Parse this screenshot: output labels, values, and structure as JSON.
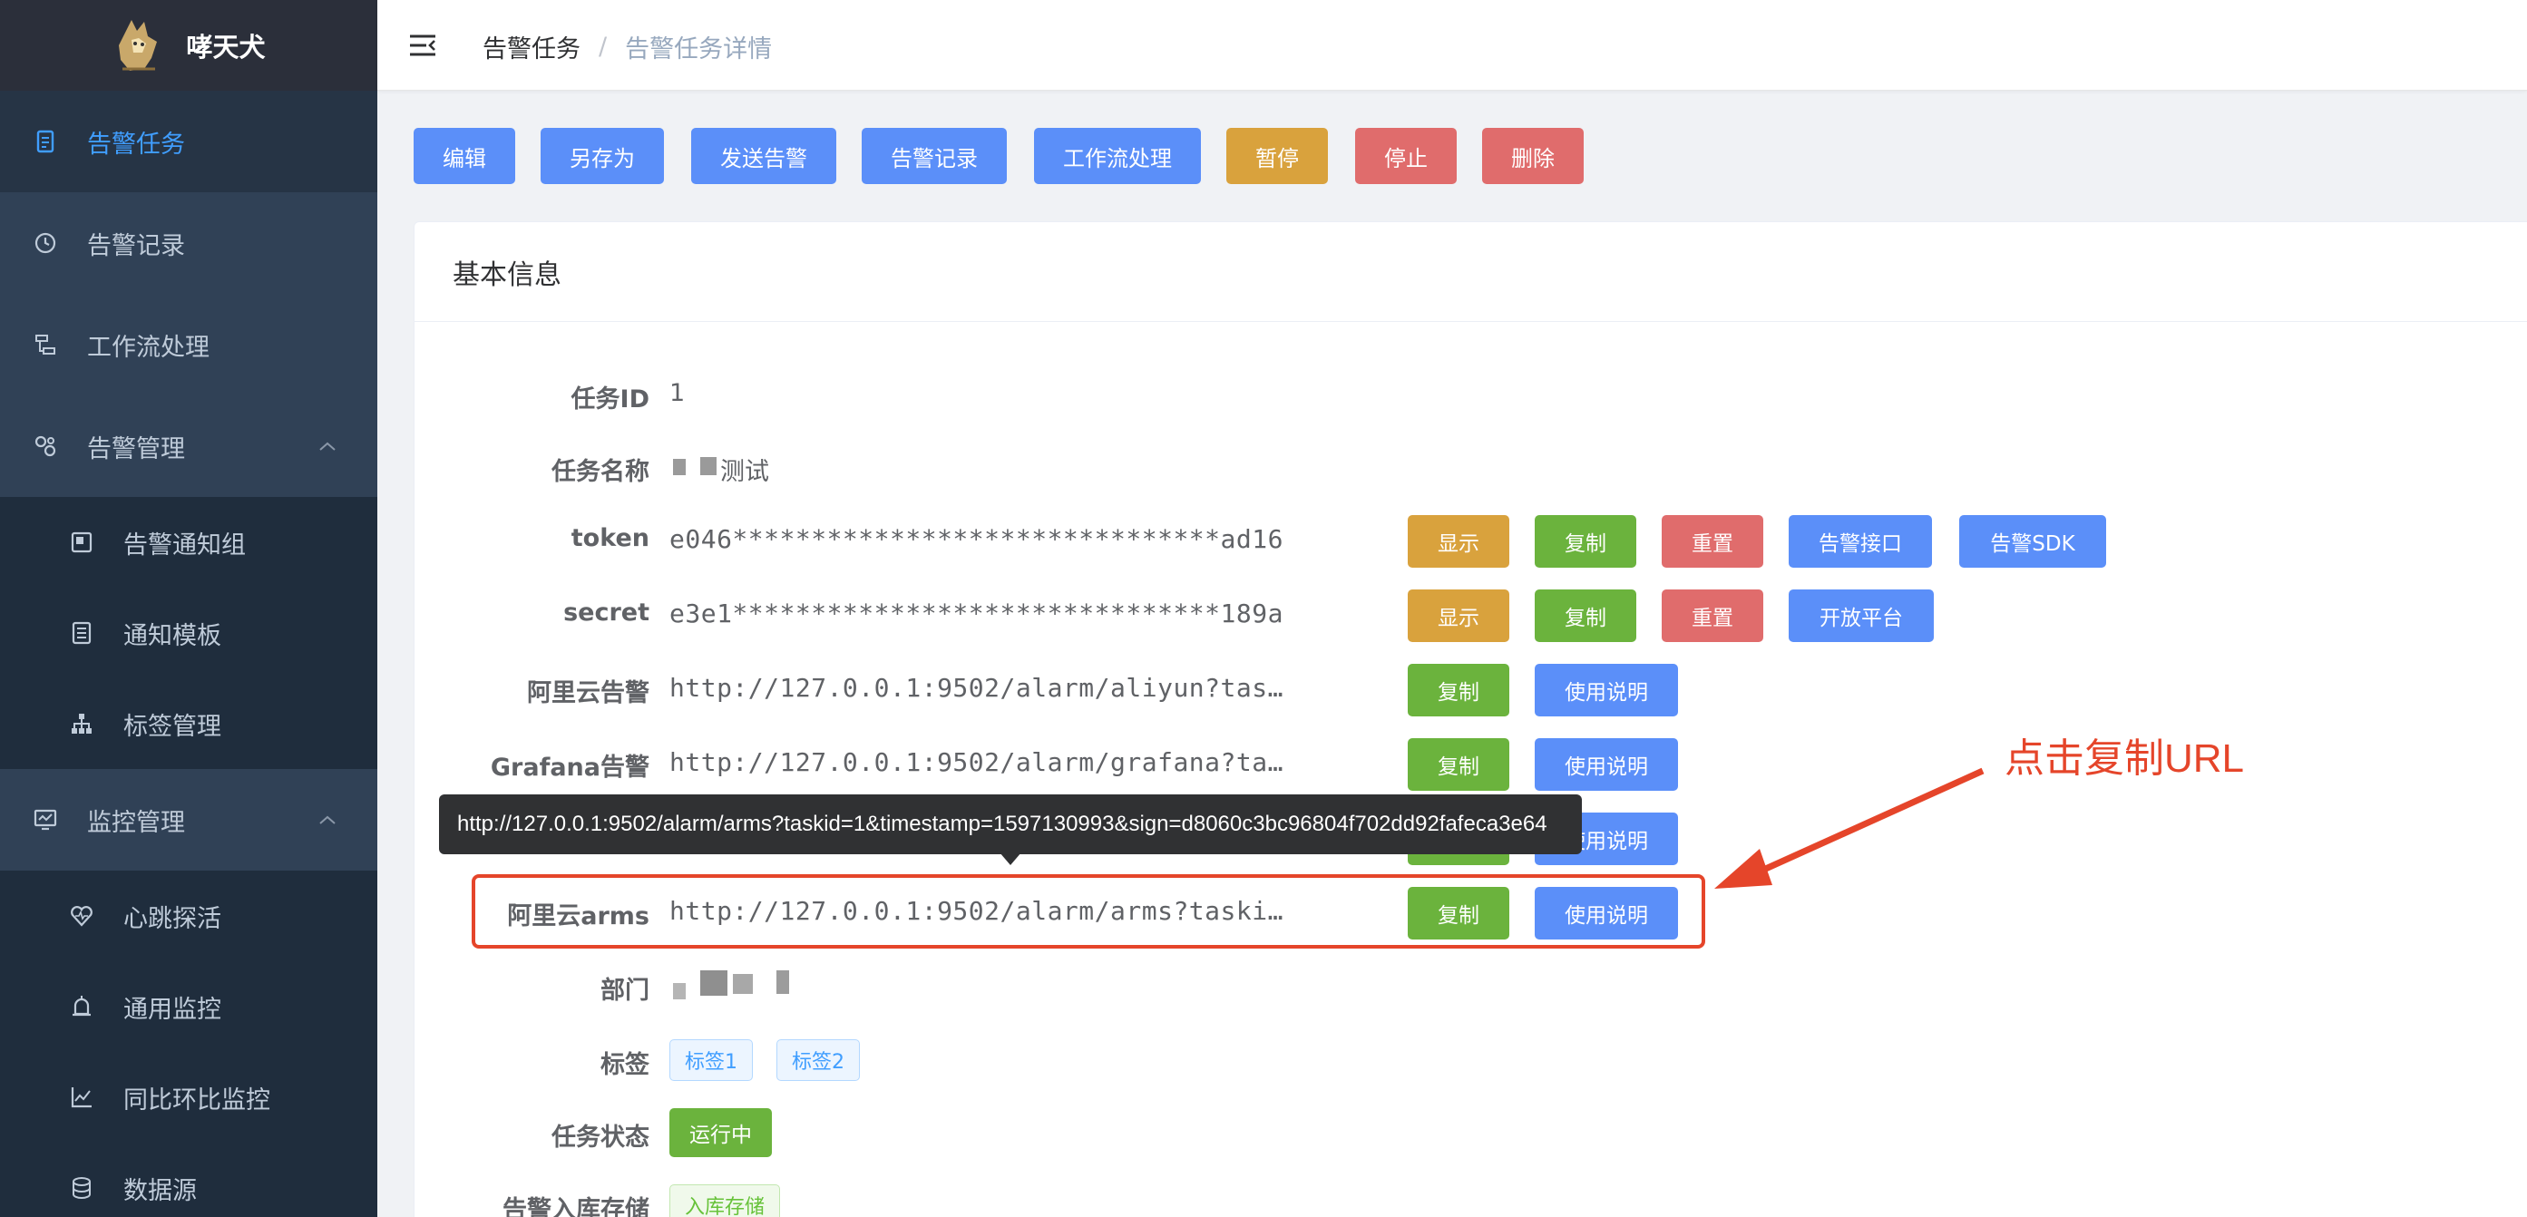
{
  "app": {
    "logo_text": "哮天犬"
  },
  "sidebar": {
    "items": [
      {
        "label": "告警任务",
        "icon": "document-icon"
      },
      {
        "label": "告警记录",
        "icon": "clock-icon"
      },
      {
        "label": "工作流处理",
        "icon": "workflow-icon"
      },
      {
        "label": "告警管理",
        "icon": "settings-icon"
      },
      {
        "label": "监控管理",
        "icon": "monitor-icon"
      }
    ],
    "alarm_sub": [
      {
        "label": "告警通知组",
        "icon": "notify-group-icon"
      },
      {
        "label": "通知模板",
        "icon": "template-icon"
      },
      {
        "label": "标签管理",
        "icon": "tree-icon"
      }
    ],
    "monitor_sub": [
      {
        "label": "心跳探活",
        "icon": "heart-icon"
      },
      {
        "label": "通用监控",
        "icon": "alarm-bell-icon"
      },
      {
        "label": "同比环比监控",
        "icon": "chart-line-icon"
      },
      {
        "label": "数据源",
        "icon": "database-icon"
      }
    ]
  },
  "breadcrumb": {
    "parent": "告警任务",
    "separator": "/",
    "current": "告警任务详情"
  },
  "toolbar": {
    "edit": "编辑",
    "save_as": "另存为",
    "send_alarm": "发送告警",
    "alarm_records": "告警记录",
    "workflow": "工作流处理",
    "pause": "暂停",
    "stop": "停止",
    "delete": "删除"
  },
  "card": {
    "title": "基本信息",
    "task_id_label": "任务ID",
    "task_id": "1",
    "task_name_label": "任务名称",
    "task_name_suffix": "测试",
    "token_label": "token",
    "token_value": "e046*******************************ad16",
    "secret_label": "secret",
    "secret_value": "e3e1*******************************189a",
    "aliyun_label": "阿里云告警",
    "aliyun_url": "http://127.0.0.1:9502/alarm/aliyun?tas…",
    "grafana_label": "Grafana告警",
    "grafana_url": "http://127.0.0.1:9502/alarm/grafana?ta…",
    "arms_label": "阿里云arms",
    "arms_url": "http://127.0.0.1:9502/alarm/arms?taski…",
    "department_label": "部门",
    "tags_label": "标签",
    "tags": [
      "标签1",
      "标签2"
    ],
    "status_label": "任务状态",
    "status": "运行中",
    "storage_label": "告警入库存储",
    "storage_tag": "入库存储"
  },
  "buttons": {
    "show": "显示",
    "copy": "复制",
    "reset": "重置",
    "alarm_api": "告警接口",
    "alarm_sdk": "告警SDK",
    "open_platform": "开放平台",
    "usage": "使用说明"
  },
  "tooltip": {
    "text": "http://127.0.0.1:9502/alarm/arms?taskid=1&timestamp=1597130993&sign=d8060c3bc96804f702dd92fafeca3e64"
  },
  "annotation": {
    "text": "点击复制URL",
    "color": "#e5452a"
  },
  "colors": {
    "primary": "#5b8ff9",
    "success": "#6bb33d",
    "warning": "#d9a23d",
    "danger": "#e06c6c",
    "sidebar": "#304156"
  }
}
